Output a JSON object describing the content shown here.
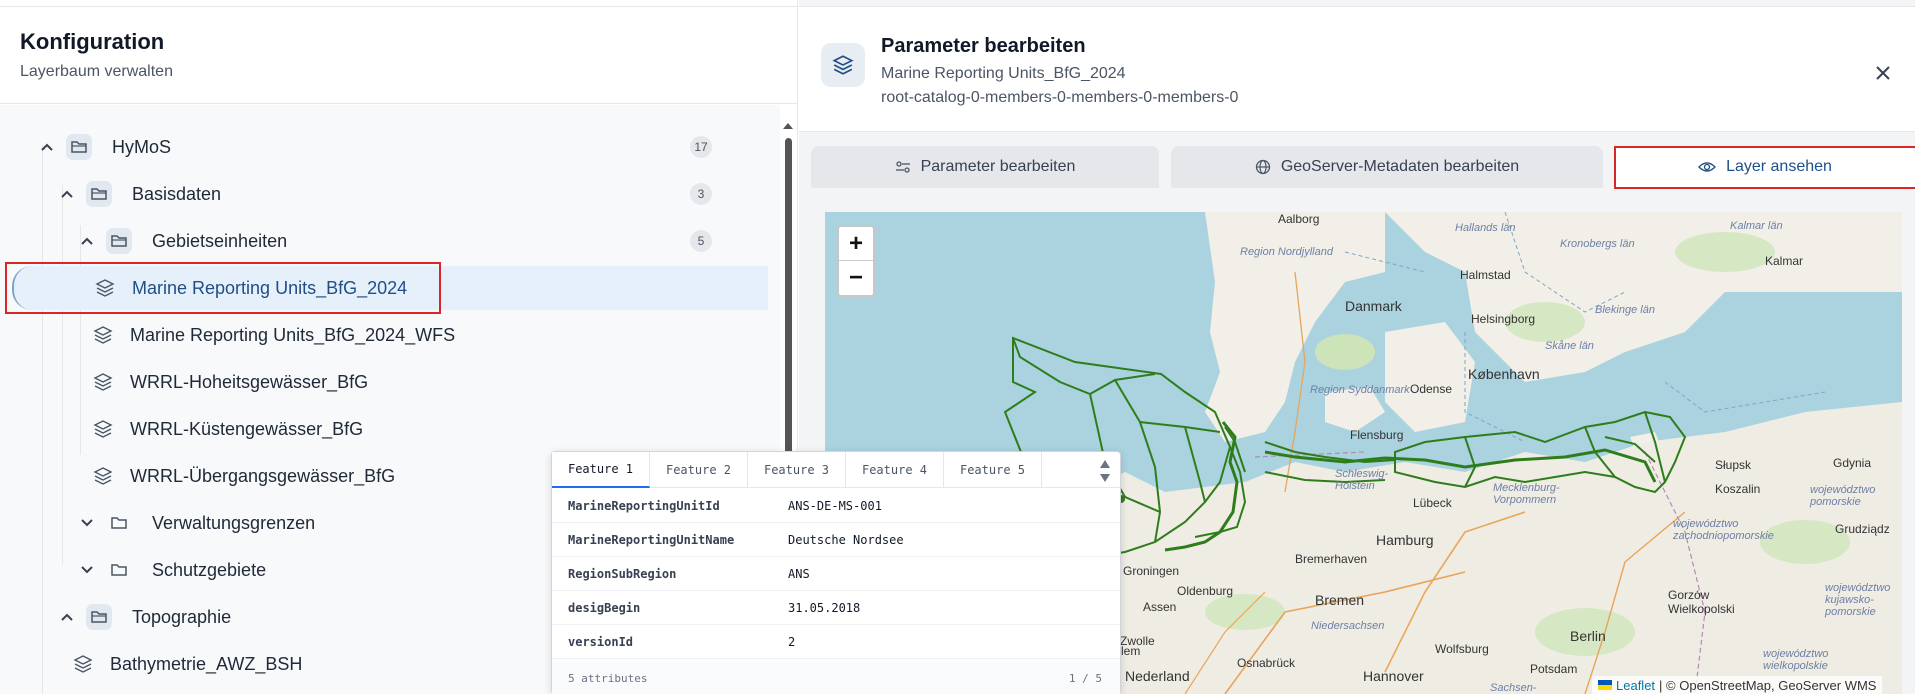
{
  "left_panel": {
    "title": "Konfiguration",
    "subtitle": "Layerbaum verwalten"
  },
  "tree": [
    {
      "label": "HyMoS",
      "count": "17",
      "type": "folder",
      "expanded": true
    },
    {
      "label": "Basisdaten",
      "count": "3",
      "type": "folder",
      "expanded": true
    },
    {
      "label": "Gebietseinheiten",
      "count": "5",
      "type": "folder",
      "expanded": true
    },
    {
      "label": "Marine Reporting Units_BfG_2024",
      "type": "layer",
      "selected": true
    },
    {
      "label": "Marine Reporting Units_BfG_2024_WFS",
      "type": "layer"
    },
    {
      "label": "WRRL-Hoheitsgewässer_BfG",
      "type": "layer"
    },
    {
      "label": "WRRL-Küstengewässer_BfG",
      "type": "layer"
    },
    {
      "label": "WRRL-Übergangsgewässer_BfG",
      "type": "layer"
    },
    {
      "label": "Verwaltungsgrenzen",
      "type": "folder",
      "expanded": false
    },
    {
      "label": "Schutzgebiete",
      "type": "folder",
      "expanded": false
    },
    {
      "label": "Topographie",
      "type": "folder",
      "expanded": true
    },
    {
      "label": "Bathymetrie_AWZ_BSH",
      "type": "layer"
    }
  ],
  "right_panel": {
    "title": "Parameter bearbeiten",
    "layer_name": "Marine Reporting Units_BfG_2024",
    "layer_path": "root-catalog-0-members-0-members-0-members-0"
  },
  "tabs": [
    {
      "label": "Parameter bearbeiten",
      "icon": "sliders-icon"
    },
    {
      "label": "GeoServer-Metadaten bearbeiten",
      "icon": "globe-icon"
    },
    {
      "label": "Layer ansehen",
      "icon": "eye-icon",
      "active": true
    }
  ],
  "map": {
    "zoom_in": "+",
    "zoom_out": "−",
    "attribution_leaflet": "Leaflet",
    "attribution_rest": "| © OpenStreetMap, GeoServer WMS",
    "labels": {
      "aalborg": "Aalborg",
      "region_nordjylland": "Region Nordjylland",
      "hallands": "Hallands län",
      "kronobergs": "Kronobergs län",
      "kalmar_lan": "Kalmar län",
      "kalmar": "Kalmar",
      "halmstad": "Halmstad",
      "danmark": "Danmark",
      "helsingborg": "Helsingborg",
      "blekinge": "Blekinge län",
      "skane": "Skåne län",
      "kobenhavn": "København",
      "region_syddanmark": "Region Syddanmark",
      "odense": "Odense",
      "flensburg": "Flensburg",
      "slupsk": "Słupsk",
      "gdynia": "Gdynia",
      "schleswig": "Schleswig-Holstein",
      "mecklenburg": "Mecklenburg-Vorpommern",
      "lubeck": "Lübeck",
      "koszalin": "Koszalin",
      "pomorskie": "województwo pomorskie",
      "zachodniopomorskie": "województwo zachodniopomorskie",
      "grudziadz": "Grudziądz",
      "hamburg": "Hamburg",
      "groningen": "Groningen",
      "bremerhaven": "Bremerhaven",
      "oldenburg": "Oldenburg",
      "bremen": "Bremen",
      "assen": "Assen",
      "niedersachsen": "Niedersachsen",
      "zwolle": "Zwolle",
      "wolfsburg": "Wolfsburg",
      "berlin": "Berlin",
      "gorzow": "Gorzów Wielkopolski",
      "kujawsko": "województwo kujawsko-pomorskie",
      "wielkopolskie": "województwo wielkopolskie",
      "osnabruck": "Osnabrück",
      "hannover": "Hannover",
      "potsdam": "Potsdam",
      "sachsen": "Sachsen-",
      "nederland": "Nederland",
      "lem": "lem"
    }
  },
  "popup": {
    "tabs": [
      "Feature 1",
      "Feature 2",
      "Feature 3",
      "Feature 4",
      "Feature 5"
    ],
    "rows": [
      {
        "key": "MarineReportingUnitId",
        "value": "ANS-DE-MS-001"
      },
      {
        "key": "MarineReportingUnitName",
        "value": "Deutsche Nordsee"
      },
      {
        "key": "RegionSubRegion",
        "value": "ANS"
      },
      {
        "key": "desigBegin",
        "value": "31.05.2018"
      },
      {
        "key": "versionId",
        "value": "2"
      }
    ],
    "footer_left": "5 attributes",
    "footer_right": "1 / 5"
  }
}
